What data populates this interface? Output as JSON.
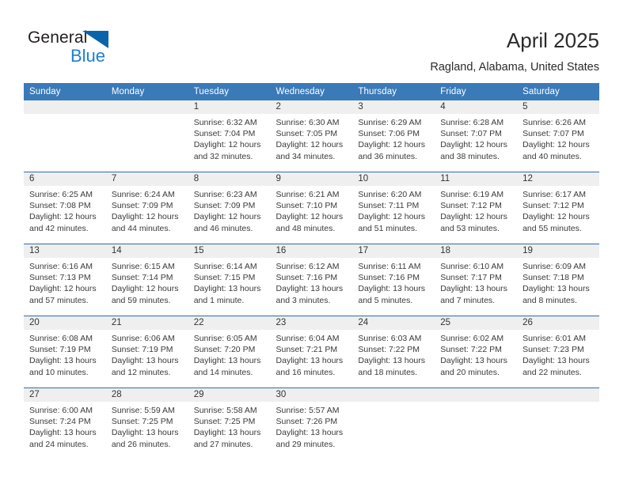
{
  "brand": {
    "name_part1": "General",
    "name_part2": "Blue",
    "logo_icon": "triangle-icon",
    "accent_dark": "#0a64ac",
    "accent_light": "#1b7fd4"
  },
  "header": {
    "title": "April 2025",
    "location": "Ragland, Alabama, United States"
  },
  "theme": {
    "header_blue": "#3a7ab8",
    "row_divider_blue": "#2e6da8",
    "daystrip_gray": "#efefef"
  },
  "calendar": {
    "weekdays": [
      "Sunday",
      "Monday",
      "Tuesday",
      "Wednesday",
      "Thursday",
      "Friday",
      "Saturday"
    ],
    "weeks": [
      [
        {
          "day": "",
          "sunrise": "",
          "sunset": "",
          "daylight": "",
          "empty": true
        },
        {
          "day": "",
          "sunrise": "",
          "sunset": "",
          "daylight": "",
          "empty": true
        },
        {
          "day": "1",
          "sunrise": "Sunrise: 6:32 AM",
          "sunset": "Sunset: 7:04 PM",
          "daylight": "Daylight: 12 hours and 32 minutes."
        },
        {
          "day": "2",
          "sunrise": "Sunrise: 6:30 AM",
          "sunset": "Sunset: 7:05 PM",
          "daylight": "Daylight: 12 hours and 34 minutes."
        },
        {
          "day": "3",
          "sunrise": "Sunrise: 6:29 AM",
          "sunset": "Sunset: 7:06 PM",
          "daylight": "Daylight: 12 hours and 36 minutes."
        },
        {
          "day": "4",
          "sunrise": "Sunrise: 6:28 AM",
          "sunset": "Sunset: 7:07 PM",
          "daylight": "Daylight: 12 hours and 38 minutes."
        },
        {
          "day": "5",
          "sunrise": "Sunrise: 6:26 AM",
          "sunset": "Sunset: 7:07 PM",
          "daylight": "Daylight: 12 hours and 40 minutes."
        }
      ],
      [
        {
          "day": "6",
          "sunrise": "Sunrise: 6:25 AM",
          "sunset": "Sunset: 7:08 PM",
          "daylight": "Daylight: 12 hours and 42 minutes."
        },
        {
          "day": "7",
          "sunrise": "Sunrise: 6:24 AM",
          "sunset": "Sunset: 7:09 PM",
          "daylight": "Daylight: 12 hours and 44 minutes."
        },
        {
          "day": "8",
          "sunrise": "Sunrise: 6:23 AM",
          "sunset": "Sunset: 7:09 PM",
          "daylight": "Daylight: 12 hours and 46 minutes."
        },
        {
          "day": "9",
          "sunrise": "Sunrise: 6:21 AM",
          "sunset": "Sunset: 7:10 PM",
          "daylight": "Daylight: 12 hours and 48 minutes."
        },
        {
          "day": "10",
          "sunrise": "Sunrise: 6:20 AM",
          "sunset": "Sunset: 7:11 PM",
          "daylight": "Daylight: 12 hours and 51 minutes."
        },
        {
          "day": "11",
          "sunrise": "Sunrise: 6:19 AM",
          "sunset": "Sunset: 7:12 PM",
          "daylight": "Daylight: 12 hours and 53 minutes."
        },
        {
          "day": "12",
          "sunrise": "Sunrise: 6:17 AM",
          "sunset": "Sunset: 7:12 PM",
          "daylight": "Daylight: 12 hours and 55 minutes."
        }
      ],
      [
        {
          "day": "13",
          "sunrise": "Sunrise: 6:16 AM",
          "sunset": "Sunset: 7:13 PM",
          "daylight": "Daylight: 12 hours and 57 minutes."
        },
        {
          "day": "14",
          "sunrise": "Sunrise: 6:15 AM",
          "sunset": "Sunset: 7:14 PM",
          "daylight": "Daylight: 12 hours and 59 minutes."
        },
        {
          "day": "15",
          "sunrise": "Sunrise: 6:14 AM",
          "sunset": "Sunset: 7:15 PM",
          "daylight": "Daylight: 13 hours and 1 minute."
        },
        {
          "day": "16",
          "sunrise": "Sunrise: 6:12 AM",
          "sunset": "Sunset: 7:16 PM",
          "daylight": "Daylight: 13 hours and 3 minutes."
        },
        {
          "day": "17",
          "sunrise": "Sunrise: 6:11 AM",
          "sunset": "Sunset: 7:16 PM",
          "daylight": "Daylight: 13 hours and 5 minutes."
        },
        {
          "day": "18",
          "sunrise": "Sunrise: 6:10 AM",
          "sunset": "Sunset: 7:17 PM",
          "daylight": "Daylight: 13 hours and 7 minutes."
        },
        {
          "day": "19",
          "sunrise": "Sunrise: 6:09 AM",
          "sunset": "Sunset: 7:18 PM",
          "daylight": "Daylight: 13 hours and 8 minutes."
        }
      ],
      [
        {
          "day": "20",
          "sunrise": "Sunrise: 6:08 AM",
          "sunset": "Sunset: 7:19 PM",
          "daylight": "Daylight: 13 hours and 10 minutes."
        },
        {
          "day": "21",
          "sunrise": "Sunrise: 6:06 AM",
          "sunset": "Sunset: 7:19 PM",
          "daylight": "Daylight: 13 hours and 12 minutes."
        },
        {
          "day": "22",
          "sunrise": "Sunrise: 6:05 AM",
          "sunset": "Sunset: 7:20 PM",
          "daylight": "Daylight: 13 hours and 14 minutes."
        },
        {
          "day": "23",
          "sunrise": "Sunrise: 6:04 AM",
          "sunset": "Sunset: 7:21 PM",
          "daylight": "Daylight: 13 hours and 16 minutes."
        },
        {
          "day": "24",
          "sunrise": "Sunrise: 6:03 AM",
          "sunset": "Sunset: 7:22 PM",
          "daylight": "Daylight: 13 hours and 18 minutes."
        },
        {
          "day": "25",
          "sunrise": "Sunrise: 6:02 AM",
          "sunset": "Sunset: 7:22 PM",
          "daylight": "Daylight: 13 hours and 20 minutes."
        },
        {
          "day": "26",
          "sunrise": "Sunrise: 6:01 AM",
          "sunset": "Sunset: 7:23 PM",
          "daylight": "Daylight: 13 hours and 22 minutes."
        }
      ],
      [
        {
          "day": "27",
          "sunrise": "Sunrise: 6:00 AM",
          "sunset": "Sunset: 7:24 PM",
          "daylight": "Daylight: 13 hours and 24 minutes."
        },
        {
          "day": "28",
          "sunrise": "Sunrise: 5:59 AM",
          "sunset": "Sunset: 7:25 PM",
          "daylight": "Daylight: 13 hours and 26 minutes."
        },
        {
          "day": "29",
          "sunrise": "Sunrise: 5:58 AM",
          "sunset": "Sunset: 7:25 PM",
          "daylight": "Daylight: 13 hours and 27 minutes."
        },
        {
          "day": "30",
          "sunrise": "Sunrise: 5:57 AM",
          "sunset": "Sunset: 7:26 PM",
          "daylight": "Daylight: 13 hours and 29 minutes."
        },
        {
          "day": "",
          "sunrise": "",
          "sunset": "",
          "daylight": "",
          "empty": true
        },
        {
          "day": "",
          "sunrise": "",
          "sunset": "",
          "daylight": "",
          "empty": true
        },
        {
          "day": "",
          "sunrise": "",
          "sunset": "",
          "daylight": "",
          "empty": true
        }
      ]
    ]
  }
}
